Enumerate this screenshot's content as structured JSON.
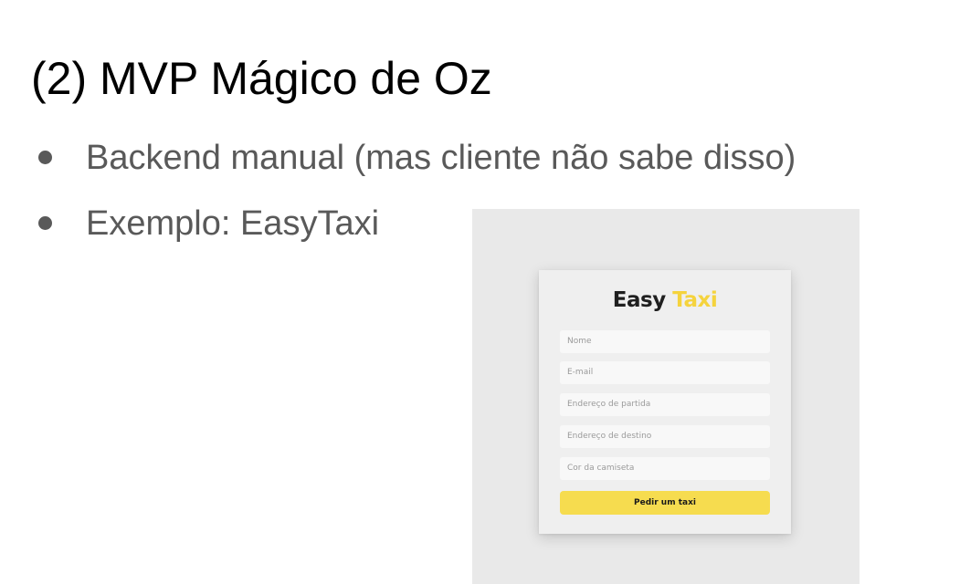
{
  "slide": {
    "title": "(2) MVP Mágico de Oz",
    "bullets": [
      "Backend manual (mas cliente não sabe disso)",
      "Exemplo: EasyTaxi"
    ]
  },
  "easytaxi_form": {
    "logo_easy": "Easy",
    "logo_taxi": "Taxi",
    "fields": [
      "Nome",
      "E-mail",
      "Endereço de partida",
      "Endereço de destino",
      "Cor da camiseta"
    ],
    "button_label": "Pedir um taxi"
  },
  "colors": {
    "title_text": "#000000",
    "body_text": "#595959",
    "brand_yellow": "#f5d33d",
    "button_yellow": "#f6dc4f",
    "screenshot_bg": "#e9e9e9"
  }
}
